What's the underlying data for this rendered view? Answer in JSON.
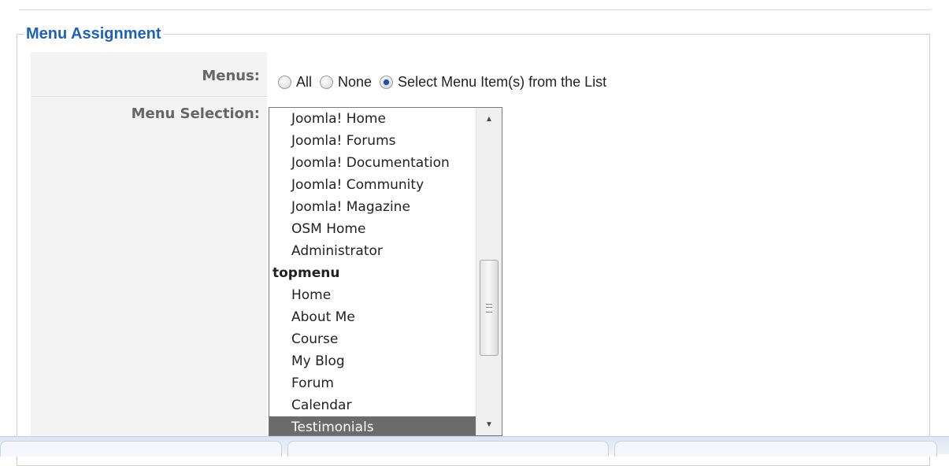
{
  "section": {
    "title": "Menu Assignment"
  },
  "menus_row": {
    "label": "Menus:",
    "options": [
      {
        "label": "All",
        "checked": false
      },
      {
        "label": "None",
        "checked": false
      },
      {
        "label": "Select Menu Item(s) from the List",
        "checked": true
      }
    ]
  },
  "selection_row": {
    "label": "Menu Selection:",
    "items": [
      {
        "label": "Joomla! Home",
        "type": "item"
      },
      {
        "label": "Joomla! Forums",
        "type": "item"
      },
      {
        "label": "Joomla! Documentation",
        "type": "item"
      },
      {
        "label": "Joomla! Community",
        "type": "item"
      },
      {
        "label": "Joomla! Magazine",
        "type": "item"
      },
      {
        "label": "OSM Home",
        "type": "item"
      },
      {
        "label": "Administrator",
        "type": "item"
      },
      {
        "label": "topmenu",
        "type": "group"
      },
      {
        "label": "Home",
        "type": "item"
      },
      {
        "label": "About Me",
        "type": "item"
      },
      {
        "label": "Course",
        "type": "item"
      },
      {
        "label": "My Blog",
        "type": "item"
      },
      {
        "label": "Forum",
        "type": "item"
      },
      {
        "label": "Calendar",
        "type": "item"
      },
      {
        "label": "Testimonials",
        "type": "item",
        "selected": true
      }
    ],
    "scroll_position_fraction": 0.55
  },
  "colors": {
    "legend_blue": "#1f62b5",
    "selected_bg": "#6b6b6b",
    "label_gray": "#666666"
  }
}
